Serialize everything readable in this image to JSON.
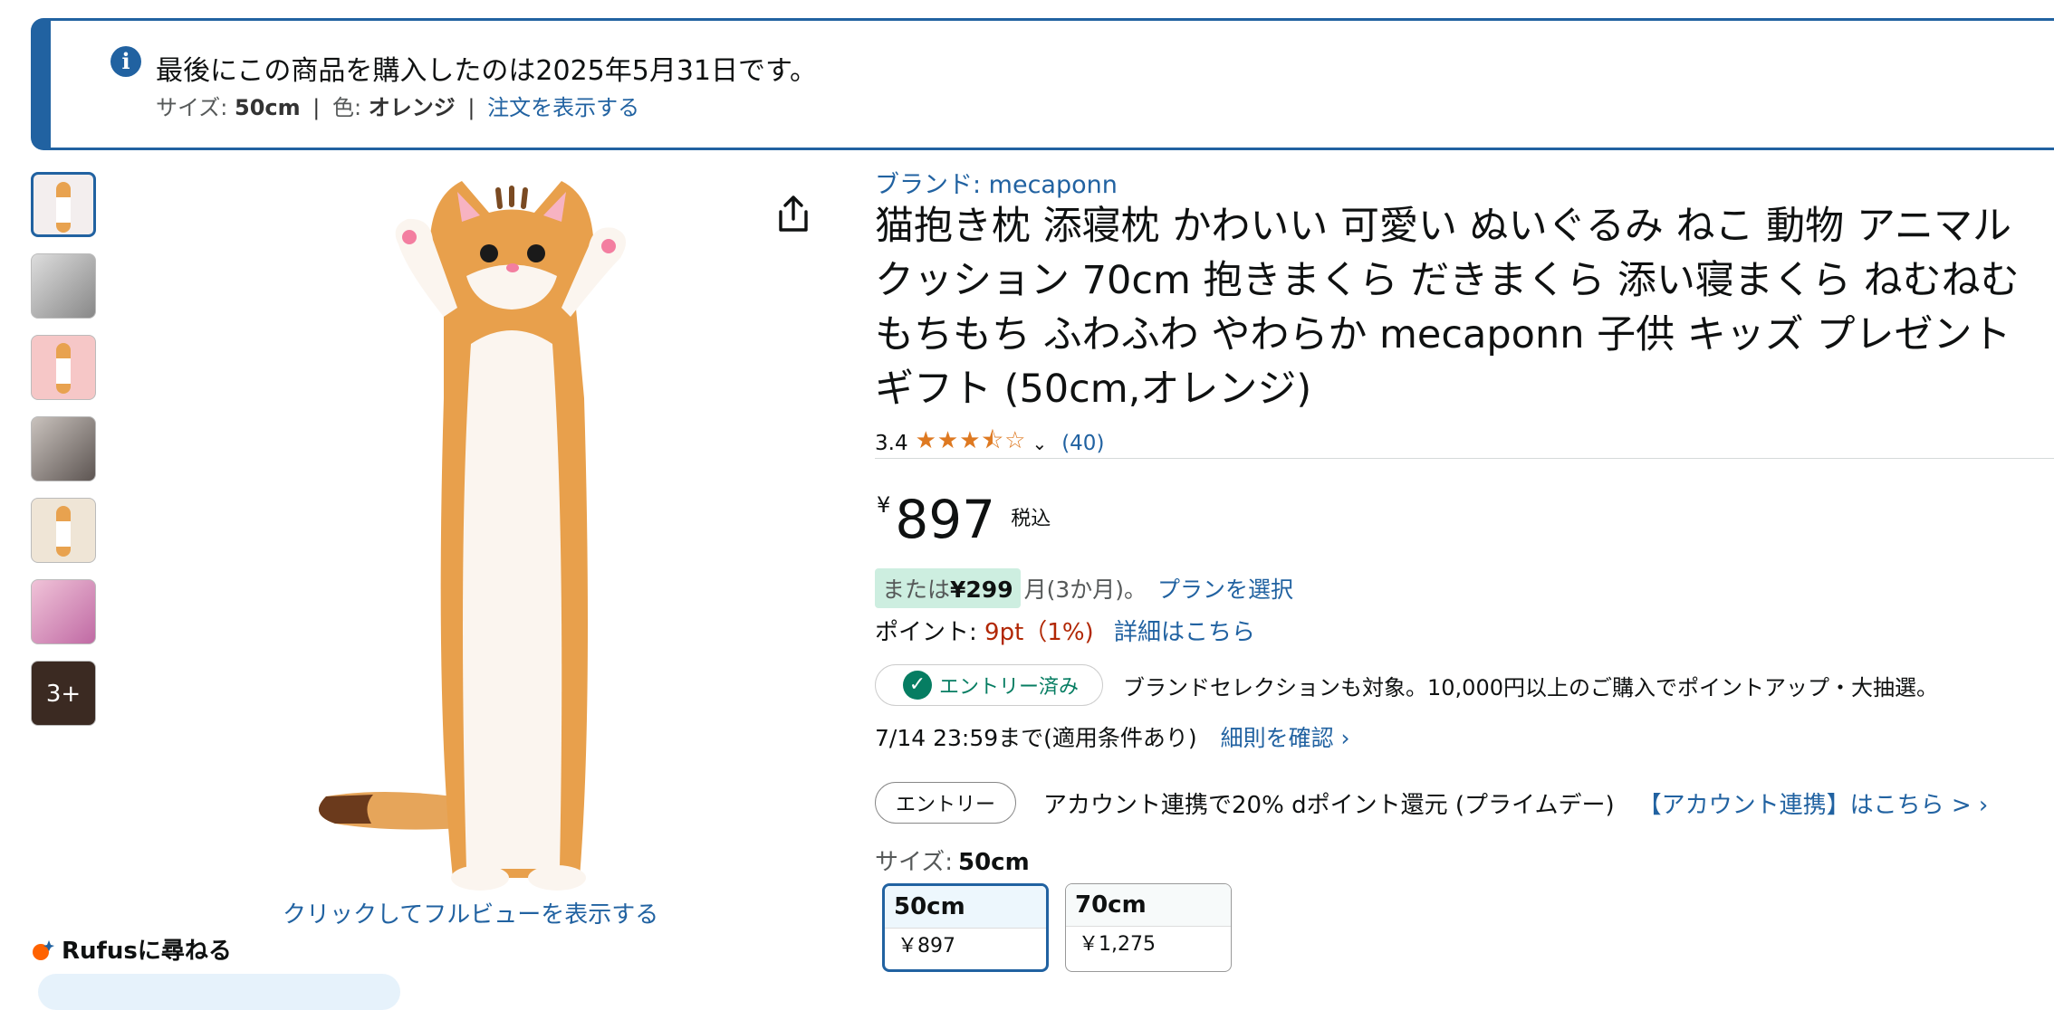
{
  "banner": {
    "title": "最後にこの商品を購入したのは2025年5月31日です。",
    "size_label": "サイズ:",
    "size_value": "50cm",
    "color_label": "色:",
    "color_value": "オレンジ",
    "separator": "|",
    "order_link": "注文を表示する"
  },
  "gallery": {
    "more_label": "3+",
    "fullview_link": "クリックしてフルビューを表示する"
  },
  "rufus": {
    "label": "Rufusに尋ねる"
  },
  "product": {
    "brand": "ブランド: mecaponn",
    "title": "猫抱き枕 添寝枕 かわいい 可愛い ぬいぐるみ ねこ 動物 アニマル クッション 70cm 抱きまくら だきまくら 添い寝まくら ねむねむ もちもち ふわふわ やわらか mecaponn 子供 キッズ プレゼント ギフト (50cm,オレンジ)",
    "rating_value": "3.4",
    "rating_stars": "★★★⯪☆",
    "rating_count": "(40)",
    "price_symbol": "¥",
    "price": "897",
    "tax_label": "税込",
    "installment_prefix": "または",
    "installment_amount": "¥299",
    "installment_suffix": "月(3か月)。",
    "installment_link": "プランを選択",
    "points_label": "ポイント:",
    "points_value": "9pt（1%)",
    "points_link": "詳細はこちら"
  },
  "promo": {
    "entered_label": "エントリー済み",
    "entered_desc": "ブランドセレクションも対象。10,000円以上のご購入でポイントアップ・大抽選。",
    "deadline": "7/14 23:59まで(適用条件あり)",
    "details_link": "細則を確認 ›",
    "entry_button": "エントリー",
    "entry_desc": "アカウント連携で20% dポイント還元 (プライムデー)",
    "entry_link": "【アカウント連携】はこちら > ›"
  },
  "size_selector": {
    "label": "サイズ:",
    "selected": "50cm",
    "options": [
      {
        "name": "50cm",
        "price": "￥897"
      },
      {
        "name": "70cm",
        "price": "￥1,275"
      }
    ]
  },
  "colors": {
    "accent": "#2162a1",
    "price_red": "#b12704",
    "star": "#de7921",
    "success": "#067d62",
    "installment_bg": "#cdeee0"
  }
}
